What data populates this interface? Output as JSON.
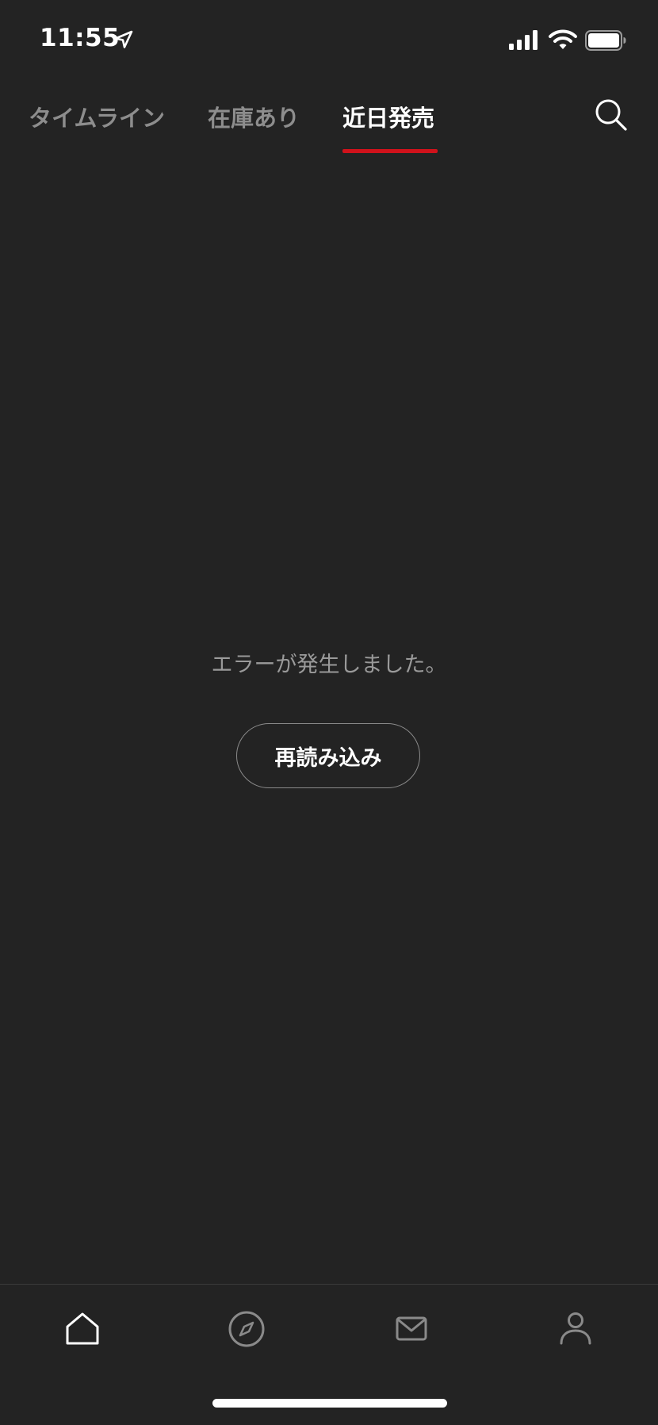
{
  "status_bar": {
    "time": "11:55"
  },
  "top_nav": {
    "tabs": [
      {
        "label": "タイムライン",
        "active": false
      },
      {
        "label": "在庫あり",
        "active": false
      },
      {
        "label": "近日発売",
        "active": true
      }
    ],
    "accent_color": "#d0121b"
  },
  "main": {
    "error_message": "エラーが発生しました。",
    "reload_label": "再読み込み"
  },
  "icons": {
    "status": [
      "location-arrow-icon",
      "cellular-signal-icon",
      "wifi-icon",
      "battery-icon"
    ],
    "top": [
      "search-icon"
    ],
    "bottom_nav": [
      "home-icon",
      "compass-icon",
      "mail-icon",
      "person-icon"
    ]
  }
}
